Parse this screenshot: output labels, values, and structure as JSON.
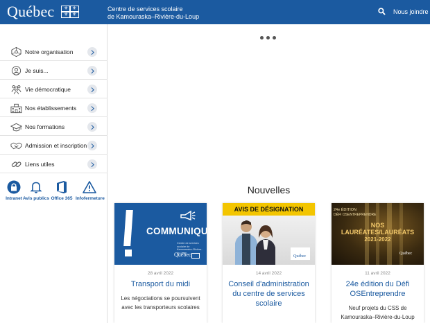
{
  "header": {
    "logo": "Québec",
    "org_line1": "Centre de services scolaire",
    "org_line2": "de Kamouraska–Rivière-du-Loup",
    "contact_label": "Nous joindre"
  },
  "menu": [
    {
      "label": "Notre organisation",
      "icon": "network-icon"
    },
    {
      "label": "Je suis...",
      "icon": "person-icon"
    },
    {
      "label": "Vie démocratique",
      "icon": "people-icon"
    },
    {
      "label": "Nos établissements",
      "icon": "building-icon"
    },
    {
      "label": "Nos formations",
      "icon": "graduation-cap-icon"
    },
    {
      "label": "Admission et inscription",
      "icon": "handshake-icon"
    },
    {
      "label": "Liens utiles",
      "icon": "link-icon"
    }
  ],
  "quick_links": [
    {
      "label": "Intranet",
      "icon": "lock-icon"
    },
    {
      "label": "Avis publics",
      "icon": "bell-icon"
    },
    {
      "label": "Office 365",
      "icon": "office-icon"
    },
    {
      "label": "Infofermeture",
      "icon": "warning-icon"
    }
  ],
  "news": {
    "title": "Nouvelles",
    "cards": [
      {
        "date": "28 avril 2022",
        "title": "Transport du midi",
        "desc": "Les négociations se poursuivent avec les transporteurs scolaires",
        "image_text": "COMMUNIQUÉ",
        "image_sub": "Centre de services scolaire de Kamouraska–Rivière-du-Loup",
        "image_logo": "Québec"
      },
      {
        "date": "14 avril 2022",
        "title": "Conseil d'administration du centre de services scolaire",
        "desc": "",
        "image_text": "AVIS DE DÉSIGNATION",
        "image_logo": "Québec"
      },
      {
        "date": "11 avril 2022",
        "title": "24e édition du Défi OSEntreprendre",
        "desc": "Neuf projets du CSS de Kamouraska–Rivière-du-Loup",
        "image_edition": "24e ÉDITION",
        "image_sub": "DÉFI OSENTREPRENDRE",
        "image_text_1": "NOS",
        "image_text_2": "LAURÉATES/LAURÉATS",
        "image_text_3": "2021-2022",
        "image_logo": "Québec"
      }
    ]
  },
  "colors": {
    "brand": "#1b5aa0",
    "yellow": "#f3c500"
  }
}
